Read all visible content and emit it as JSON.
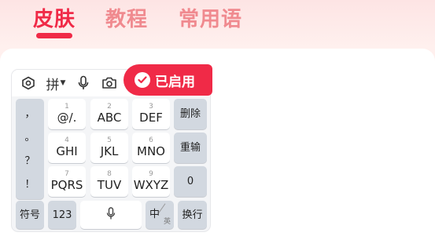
{
  "tabs": [
    {
      "label": "皮肤",
      "active": true
    },
    {
      "label": "教程",
      "active": false
    },
    {
      "label": "常用语",
      "active": false
    }
  ],
  "keyboard": {
    "toolbar": {
      "settings_icon": "hexagon-settings-icon",
      "input_mode": "拼",
      "mic_icon": "microphone-icon",
      "camera_icon": "camera-icon"
    },
    "punct_column": [
      "，",
      "。",
      "？",
      "！"
    ],
    "rows": [
      [
        {
          "num": "1",
          "label": "@/."
        },
        {
          "num": "2",
          "label": "ABC"
        },
        {
          "num": "3",
          "label": "DEF"
        }
      ],
      [
        {
          "num": "4",
          "label": "GHI"
        },
        {
          "num": "5",
          "label": "JKL"
        },
        {
          "num": "6",
          "label": "MNO"
        }
      ],
      [
        {
          "num": "7",
          "label": "PQRS"
        },
        {
          "num": "8",
          "label": "TUV"
        },
        {
          "num": "9",
          "label": "WXYZ"
        }
      ]
    ],
    "right_keys": [
      "删除",
      "重输",
      "0"
    ],
    "bottom": {
      "symbols": "符号",
      "numbers": "123",
      "zh": "中",
      "en": "英",
      "enter": "换行"
    }
  },
  "badge": {
    "label": "已启用"
  },
  "colors": {
    "accent": "#f02a47",
    "inactive_tab": "#f08a8f",
    "gray_key": "#d2d8e0"
  }
}
